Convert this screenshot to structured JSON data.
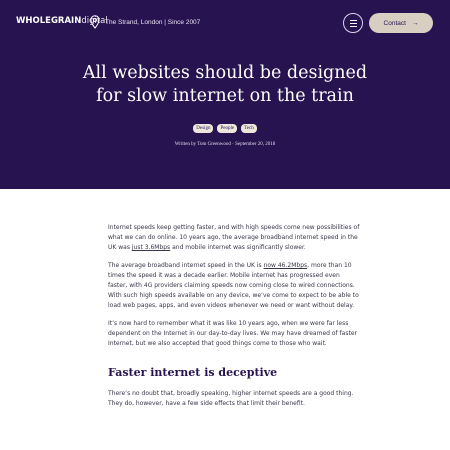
{
  "header": {
    "logo_bold": "WHOLEGRAIN",
    "logo_light": "digital",
    "location": "The Strand, London  |  Since 2007",
    "contact_label": "Contact",
    "contact_arrow": "→"
  },
  "hero": {
    "title_line1": "All websites should be designed",
    "title_line2": "for slow internet on the train",
    "tags": [
      "Design",
      "People",
      "Tech"
    ],
    "byline": "Written by Tom Greenwood · September 20, 2018"
  },
  "article": {
    "p1_a": "Internet speeds keep getting faster, and with high speeds come new possibilities of what we can do online. 10 years ago, the average broadband internet speed in the UK was ",
    "p1_link": "just 3.6Mbps",
    "p1_b": " and mobile internet was significantly slower.",
    "p2_a": "The average broadband internet speed in the UK is ",
    "p2_link": "now 46.2Mbps",
    "p2_b": ", more than 10 times the speed it was a decade earlier.  Mobile internet has progressed even faster, with 4G providers claiming speeds now coming close to wired connections. With such high speeds available on any device, we’ve come to expect to be able to load web pages, apps, and even videos whenever we need or want without delay.",
    "p3": "It’s now hard to remember what it was like 10 years ago, when we were far less dependent on the Internet in our day-to-day lives.  We may have dreamed of faster Internet, but we also accepted that good things come to those who wait.",
    "heading": "Faster internet is deceptive",
    "p4": "There’s no doubt that, broadly speaking, higher internet speeds are a good thing. They do, however, have a few side effects that limit their benefit."
  },
  "colors": {
    "hero_bg": "#26134f",
    "contact_bg": "#d8cfc2",
    "tag_bg": "#ece7dc"
  }
}
